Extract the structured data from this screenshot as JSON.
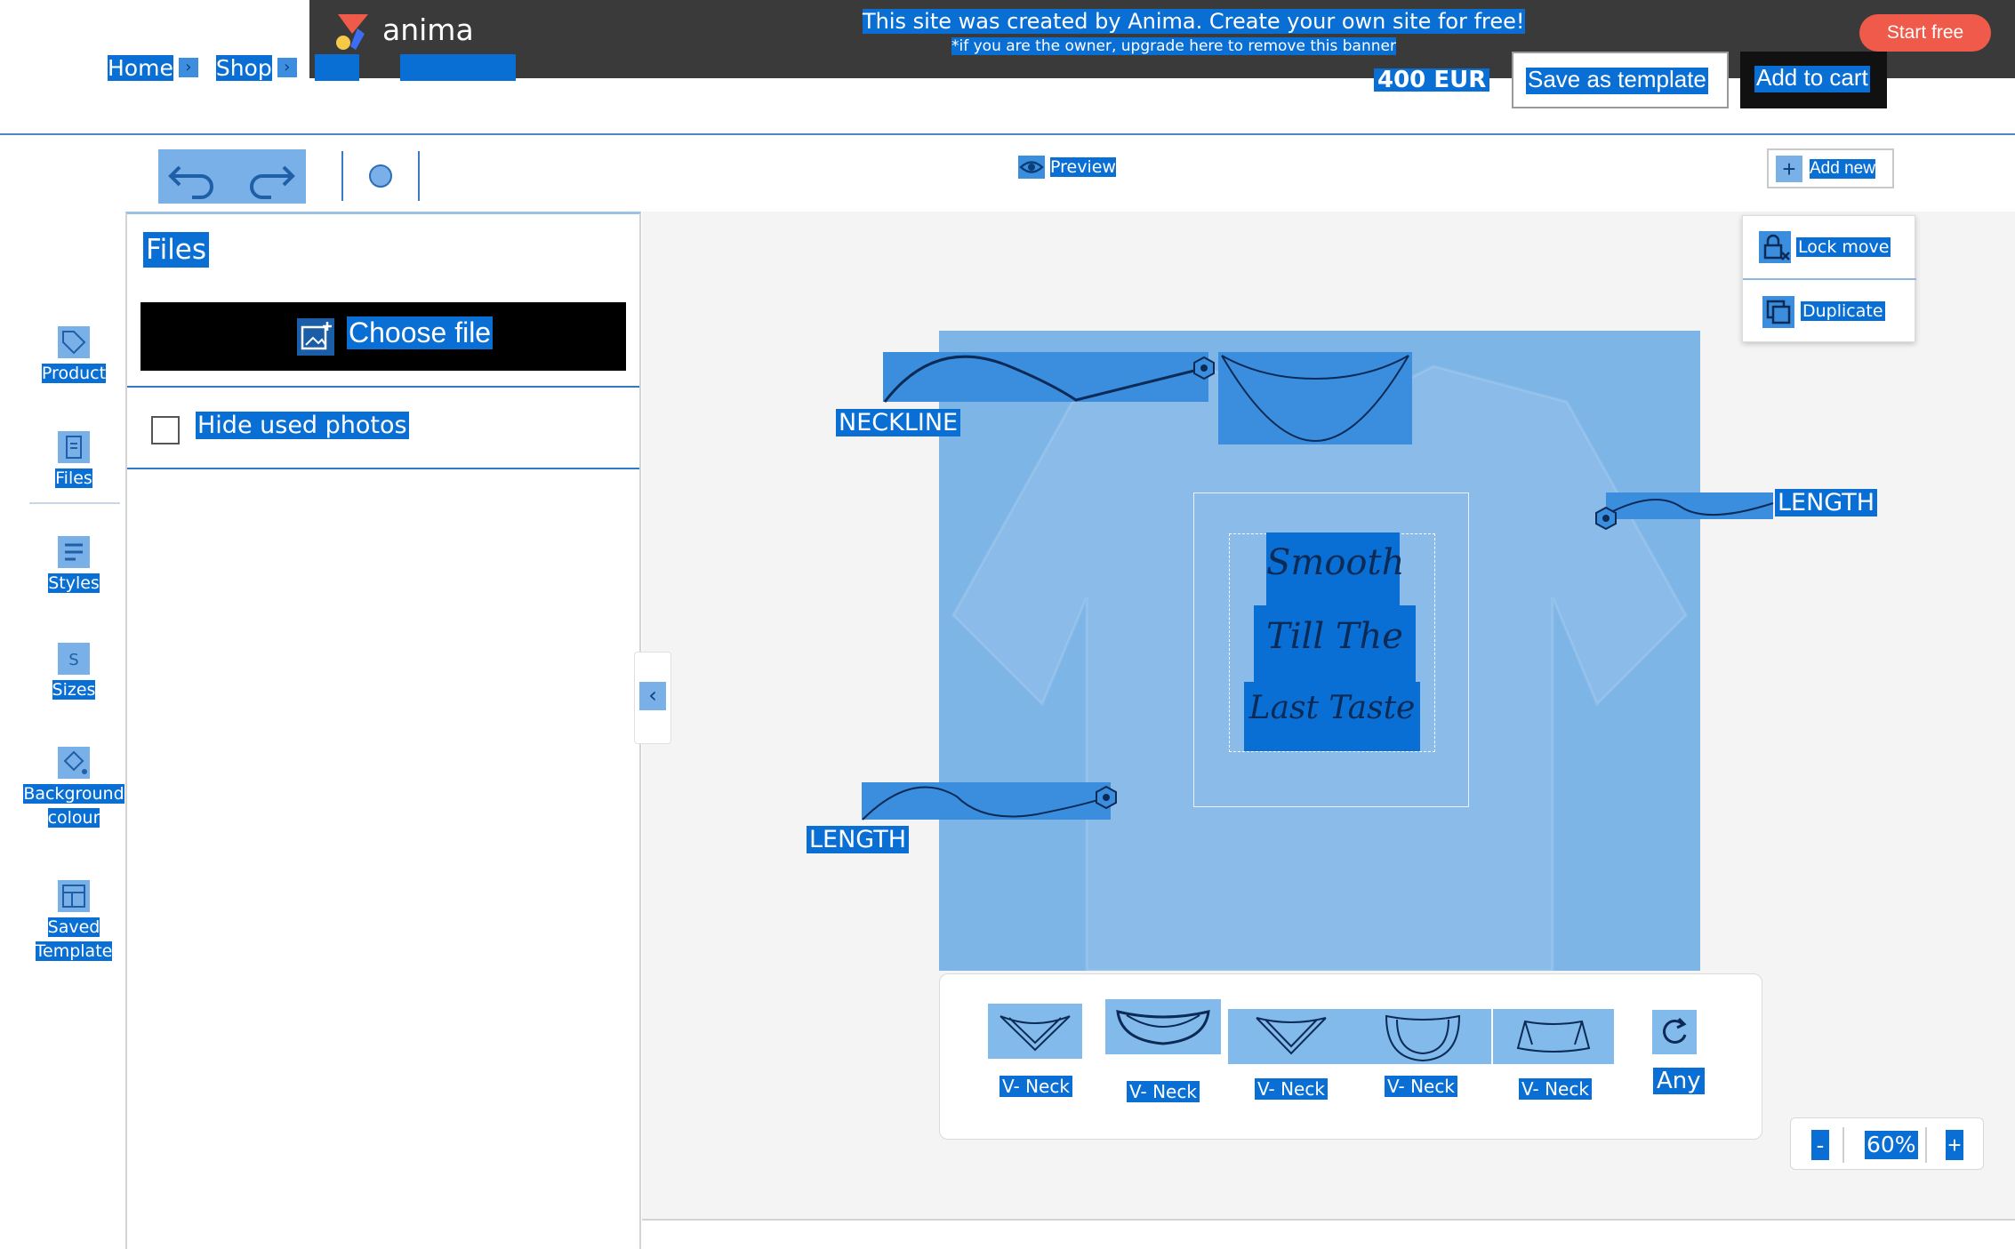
{
  "banner": {
    "brand": "anima",
    "message": "This site was created by Anima. Create your own site for free!",
    "sub": "*if you are the owner, upgrade here to remove this banner",
    "cta": "Start free"
  },
  "header": {
    "breadcrumbs": [
      "Home",
      "Shop"
    ],
    "price": "400 EUR",
    "save_template": "Save as template",
    "add_to_cart": "Add to cart"
  },
  "toolbar": {
    "preview": "Preview",
    "add_new": "Add new"
  },
  "sidebar": {
    "items": [
      {
        "label": "Product",
        "icon": "tag-icon"
      },
      {
        "label": "Files",
        "icon": "files-icon"
      },
      {
        "label": "Styles",
        "icon": "styles-icon"
      },
      {
        "label": "Sizes",
        "icon": "sizes-icon"
      },
      {
        "label": "Background colour",
        "icon": "paint-bucket-icon"
      },
      {
        "label": "Saved Template",
        "icon": "template-icon"
      }
    ]
  },
  "files_panel": {
    "title": "Files",
    "choose_file": "Choose file",
    "hide_used": "Hide used photos"
  },
  "canvas": {
    "callouts": {
      "neckline": "NECKLINE",
      "length_right": "LENGTH",
      "length_left": "LENGTH"
    },
    "design_text": [
      "Smooth",
      "Till The",
      "Last Taste"
    ]
  },
  "neck_options": [
    {
      "label": "V- Neck"
    },
    {
      "label": "V- Neck"
    },
    {
      "label": "V- Neck"
    },
    {
      "label": "V- Neck"
    },
    {
      "label": "V- Neck"
    }
  ],
  "neck_any": "Any",
  "context_menu": {
    "lock_move": "Lock move",
    "duplicate": "Duplicate"
  },
  "zoom": {
    "minus": "-",
    "value": "60%",
    "plus": "+"
  },
  "colors": {
    "selection": "#0a6fd4",
    "banner_bg": "#3a3a3a",
    "cta": "#f05a4a",
    "canvas_bg": "#f4f4f4"
  }
}
